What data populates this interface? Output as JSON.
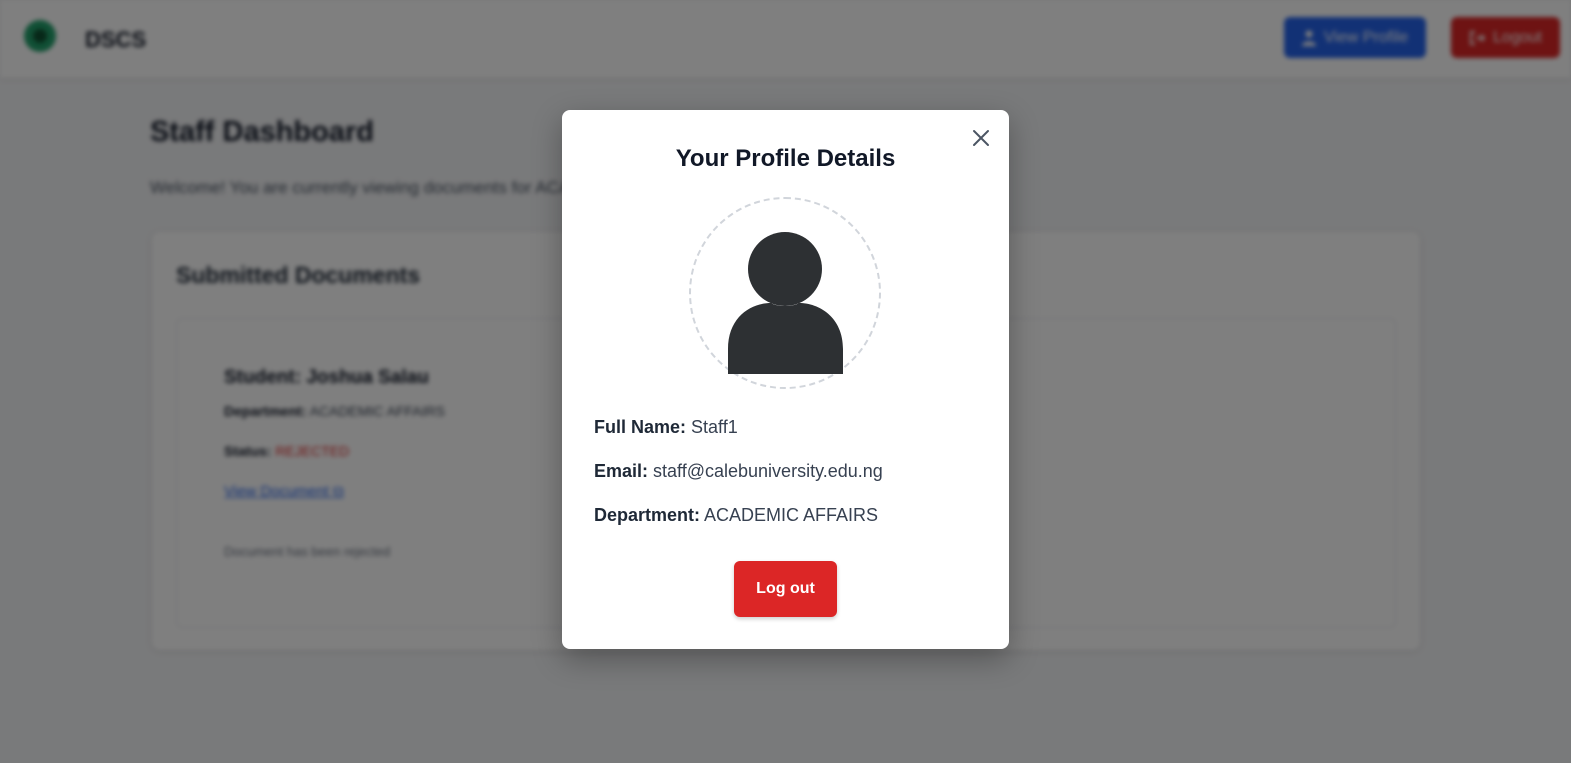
{
  "header": {
    "brand": "DSCS",
    "view_profile_label": "View Profile",
    "logout_label": "Logout"
  },
  "page": {
    "title": "Staff Dashboard",
    "welcome": "Welcome! You are currently viewing documents for ACADEMIC AFFAIRS"
  },
  "documents": {
    "title": "Submitted Documents",
    "item": {
      "student_label": "Student:",
      "student_name": "Joshua Salau",
      "department_label": "Department:",
      "department": "ACADEMIC AFFAIRS",
      "status_label": "Status:",
      "status": "REJECTED",
      "view_link": "View Document",
      "note": "Document has been rejected"
    }
  },
  "modal": {
    "title": "Your Profile Details",
    "full_name_label": "Full Name:",
    "full_name": "Staff1",
    "email_label": "Email:",
    "email": "staff@calebuniversity.edu.ng",
    "department_label": "Department:",
    "department": "ACADEMIC AFFAIRS",
    "logout_label": "Log out"
  },
  "colors": {
    "primary": "#2563eb",
    "danger": "#dc2626",
    "overlay": "rgba(0,0,0,0.5)"
  }
}
